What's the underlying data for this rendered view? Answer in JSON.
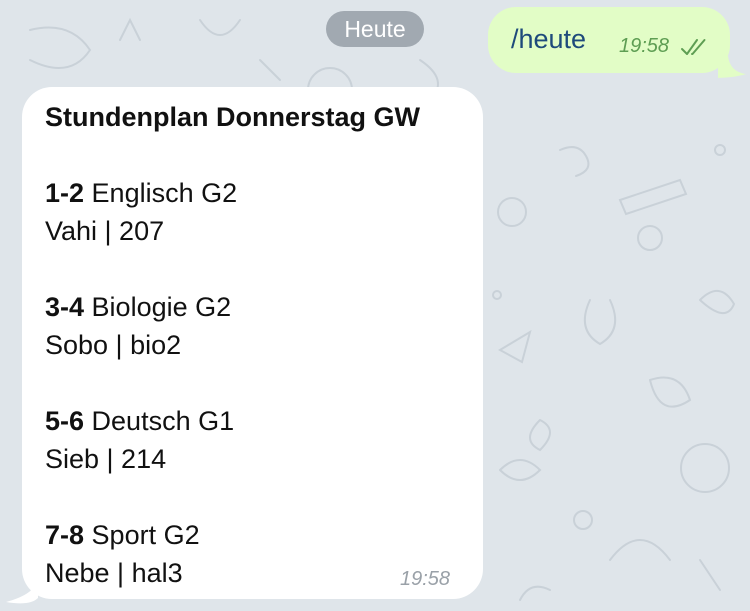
{
  "date_divider": "Heute",
  "outgoing": {
    "text": "/heute",
    "time": "19:58",
    "status_icon": "double-check-read-icon"
  },
  "incoming": {
    "title": "Stundenplan Donnerstag GW",
    "lessons": [
      {
        "period": "1-2",
        "subject": "Englisch G2",
        "details": "Vahi | 207"
      },
      {
        "period": "3-4",
        "subject": "Biologie G2",
        "details": "Sobo | bio2"
      },
      {
        "period": "5-6",
        "subject": "Deutsch G1",
        "details": "Sieb | 214"
      },
      {
        "period": "7-8",
        "subject": "Sport G2",
        "details": "Nebe | hal3"
      }
    ],
    "time": "19:58"
  },
  "colors": {
    "background": "#dfe5ea",
    "outgoing_bubble": "#e2fdc6",
    "incoming_bubble": "#ffffff",
    "date_pill": "#a1a9b1",
    "outgoing_text": "#1e4a7b",
    "outgoing_time": "#5e9e53"
  }
}
